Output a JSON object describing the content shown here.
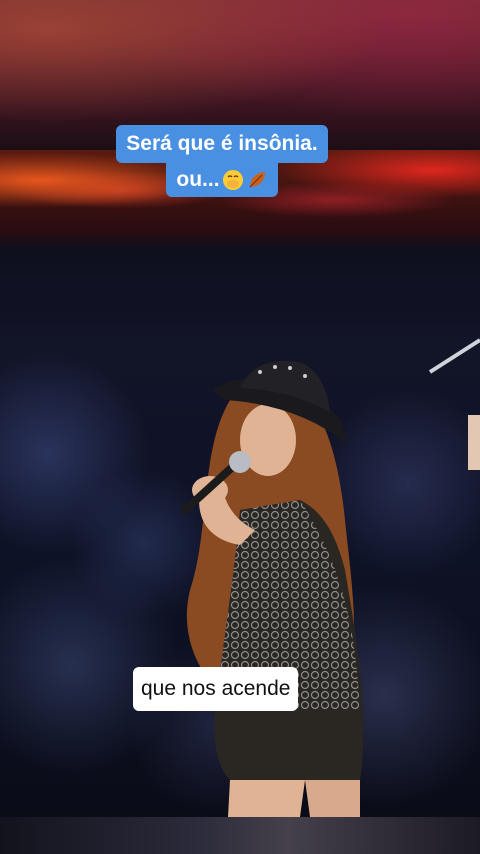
{
  "captions": {
    "top_line1": "Será que é insônia.",
    "top_line2": "ou...",
    "top_emojis": [
      "hand-over-mouth-emoji",
      "fallen-leaf-emoji"
    ],
    "subtitle": "que nos acende"
  },
  "colors": {
    "caption_bg": "#4a90e2",
    "subtitle_bg": "#ffffff"
  }
}
